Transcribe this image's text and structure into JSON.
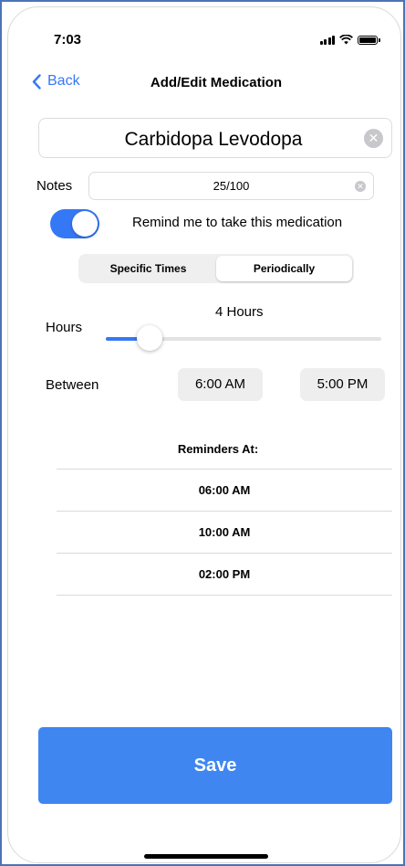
{
  "status_bar": {
    "time": "7:03"
  },
  "nav": {
    "back_label": "Back",
    "title": "Add/Edit Medication"
  },
  "medication": {
    "name": "Carbidopa Levodopa"
  },
  "notes": {
    "label": "Notes",
    "value": "25/100"
  },
  "reminder_toggle": {
    "label": "Remind me to take this medication",
    "on": true
  },
  "segments": [
    {
      "label": "Specific Times",
      "selected": false
    },
    {
      "label": "Periodically",
      "selected": true
    }
  ],
  "hours": {
    "label": "Hours",
    "value_text": "4 Hours",
    "slider_fraction": 0.16
  },
  "between": {
    "label": "Between",
    "start": "6:00 AM",
    "end": "5:00 PM"
  },
  "reminders": {
    "title": "Reminders At:",
    "times": [
      "06:00 AM",
      "10:00 AM",
      "02:00 PM"
    ]
  },
  "save_label": "Save",
  "colors": {
    "accent": "#3478f6",
    "save_button": "#3f86f1"
  }
}
